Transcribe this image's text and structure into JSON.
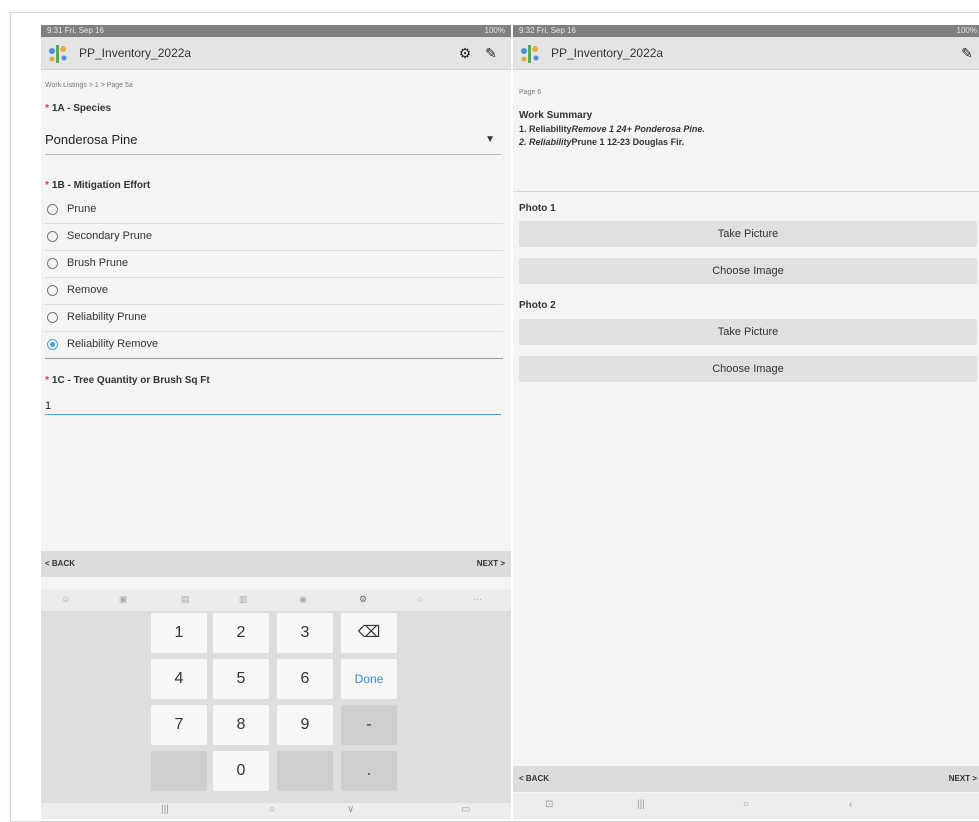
{
  "left": {
    "status": {
      "time": "9:31 Fri, Sep 16",
      "right": "100%"
    },
    "app_title": "PP_Inventory_2022a",
    "breadcrumb": "Work Listings > 1 > Page 5a",
    "q1a": {
      "label": "1A - Species",
      "value": "Ponderosa Pine"
    },
    "q1b": {
      "label": "1B - Mitigation Effort",
      "options": [
        "Prune",
        "Secondary Prune",
        "Brush Prune",
        "Remove",
        "Reliability Prune",
        "Reliability Remove"
      ],
      "selected": "Reliability Remove"
    },
    "q1c": {
      "label": "1C - Tree Quantity or Brush Sq Ft",
      "value": "1"
    },
    "nav": {
      "back": "< BACK",
      "next": "NEXT >"
    },
    "keypad": {
      "k1": "1",
      "k2": "2",
      "k3": "3",
      "k4": "4",
      "k5": "5",
      "k6": "6",
      "k7": "7",
      "k8": "8",
      "k9": "9",
      "k0": "0",
      "done": "Done",
      "minus": "-",
      "dot": ".",
      "backspace": "⌫"
    }
  },
  "right": {
    "status": {
      "time": "9:32 Fri, Sep 16",
      "right": "100%"
    },
    "app_title": "PP_Inventory_2022a",
    "page_label": "Page 6",
    "summary_title": "Work Summary",
    "line1_prefix": "1. Reliability",
    "line1_italic": "Remove 1 24+ Ponderosa Pine.",
    "line2_italic": "2. Reliability",
    "line2_rest": "Prune 1 12-23 Douglas Fir.",
    "photo1": {
      "label": "Photo 1",
      "take": "Take Picture",
      "choose": "Choose Image"
    },
    "photo2": {
      "label": "Photo 2",
      "take": "Take Picture",
      "choose": "Choose Image"
    },
    "nav": {
      "back": "< BACK",
      "next": "NEXT >"
    }
  },
  "colors": {
    "accent": "#4a9fd8",
    "required": "#e53935",
    "done_key": "#3b86d6"
  },
  "icons": [
    "app-logo-icon",
    "gear-icon",
    "edit-icon",
    "dropdown-arrow-icon",
    "backspace-icon"
  ]
}
